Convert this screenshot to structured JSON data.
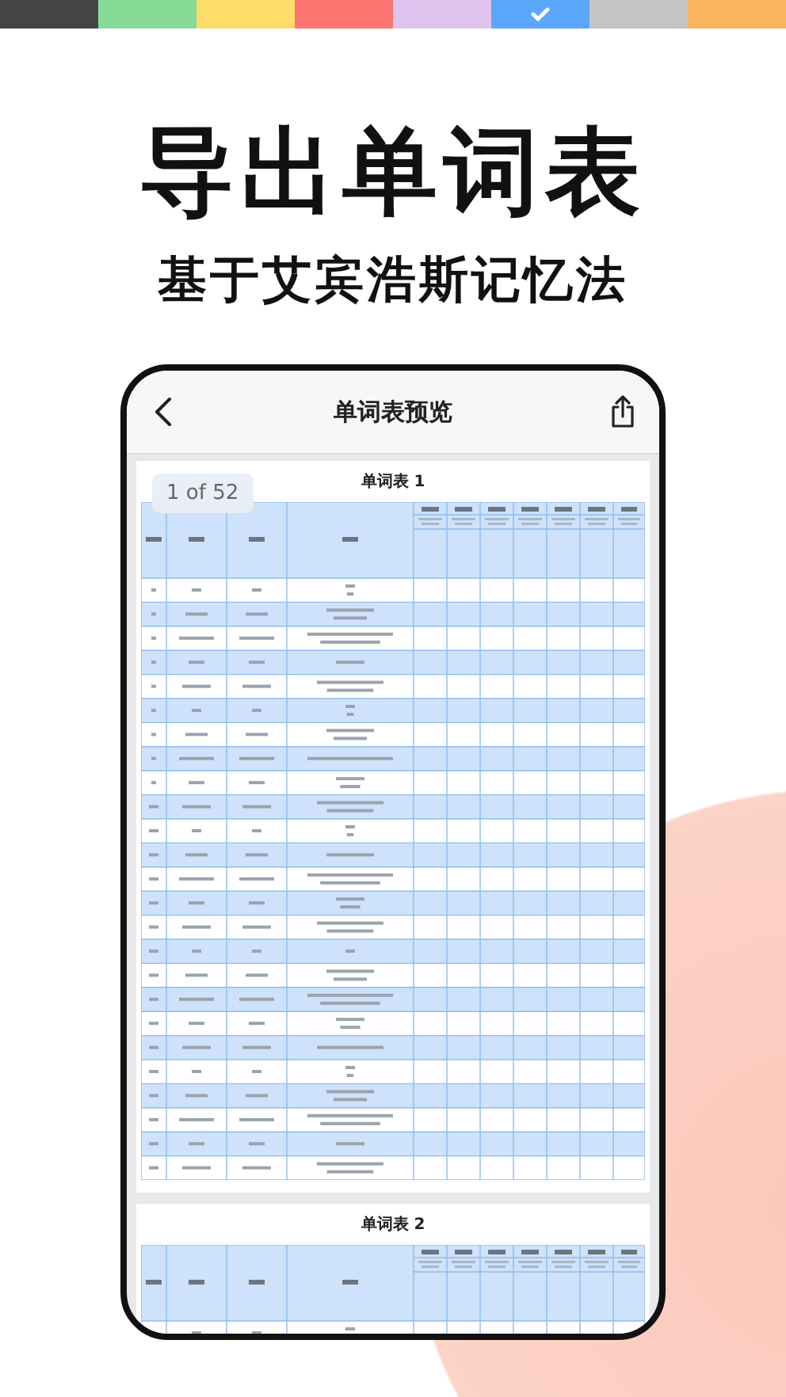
{
  "color_bar": [
    {
      "color": "#444444",
      "selected": false
    },
    {
      "color": "#86dc97",
      "selected": false
    },
    {
      "color": "#fddc6a",
      "selected": false
    },
    {
      "color": "#fb7570",
      "selected": false
    },
    {
      "color": "#e0c3ef",
      "selected": false
    },
    {
      "color": "#5aa7fc",
      "selected": true
    },
    {
      "color": "#c4c4c4",
      "selected": false
    },
    {
      "color": "#fcb55e",
      "selected": false
    }
  ],
  "headline": "导出单词表",
  "subheadline": "基于艾宾浩斯记忆法",
  "screen": {
    "title": "单词表预览",
    "page_indicator": "1 of 52",
    "sheets": [
      {
        "title": "单词表 1"
      },
      {
        "title": "单词表 2"
      }
    ]
  }
}
